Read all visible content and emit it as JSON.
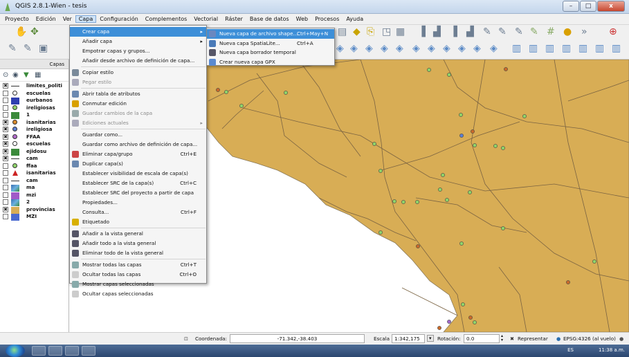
{
  "window": {
    "title": "QGIS 2.8.1-Wien - tesis",
    "min": "–",
    "max": "□",
    "close": "x"
  },
  "menubar": [
    "Proyecto",
    "Edición",
    "Ver",
    "Capa",
    "Configuración",
    "Complementos",
    "Vectorial",
    "Ráster",
    "Base de datos",
    "Web",
    "Procesos",
    "Ayuda"
  ],
  "layers_panel": {
    "title": "Capas",
    "layers": [
      {
        "label": "limites_politi",
        "checked": true,
        "symbol": "line"
      },
      {
        "label": "escuelas",
        "checked": false,
        "symbol": "dot-white"
      },
      {
        "label": "eurbanos",
        "checked": false,
        "symbol": "blue"
      },
      {
        "label": "ireligiosas",
        "checked": false,
        "symbol": "dot-green"
      },
      {
        "label": "1",
        "checked": false,
        "symbol": "green-fill"
      },
      {
        "label": "isanitarias",
        "checked": true,
        "symbol": "dot-orange"
      },
      {
        "label": "ireligiosa",
        "checked": true,
        "symbol": "dot-blue"
      },
      {
        "label": "FFAA",
        "checked": true,
        "symbol": "dot-purple"
      },
      {
        "label": "escuelas",
        "checked": true,
        "symbol": "dot-white"
      },
      {
        "label": "ejidosu",
        "checked": true,
        "symbol": "green-fill"
      },
      {
        "label": "cam",
        "checked": true,
        "symbol": "line"
      },
      {
        "label": "ffaa",
        "checked": false,
        "symbol": "dot-green"
      },
      {
        "label": "isanitarias",
        "checked": false,
        "symbol": "tri-red"
      },
      {
        "label": "cam",
        "checked": false,
        "symbol": "line"
      },
      {
        "label": "ma",
        "checked": false,
        "symbol": "raster"
      },
      {
        "label": "mzi",
        "checked": false,
        "symbol": "purple-fill"
      },
      {
        "label": "2",
        "checked": false,
        "symbol": "raster"
      },
      {
        "label": "provincias",
        "checked": true,
        "symbol": "tan"
      },
      {
        "label": "MZI",
        "checked": false,
        "symbol": "blue-fill"
      }
    ]
  },
  "capa_menu": {
    "items": [
      {
        "label": "Crear capa",
        "shortcut": "",
        "submenu": true,
        "highlighted": true,
        "disabled": false,
        "icon": "none-icon"
      },
      {
        "label": "Añadir capa",
        "shortcut": "",
        "submenu": true,
        "disabled": false,
        "icon": "none-icon"
      },
      {
        "label": "Empotrar capas y grupos...",
        "shortcut": "",
        "disabled": false,
        "icon": "none-icon"
      },
      {
        "label": "Añadir desde archivo de definición de capa...",
        "shortcut": "",
        "disabled": false,
        "icon": "none-icon"
      },
      {
        "sep": true
      },
      {
        "label": "Copiar estilo",
        "shortcut": "",
        "disabled": false,
        "icon": "copy-style-icon"
      },
      {
        "label": "Pegar estilo",
        "shortcut": "",
        "disabled": true,
        "icon": "paste-style-icon"
      },
      {
        "sep": true
      },
      {
        "label": "Abrir tabla de atributos",
        "shortcut": "",
        "disabled": false,
        "icon": "table-icon"
      },
      {
        "label": "Conmutar edición",
        "shortcut": "",
        "disabled": false,
        "icon": "pencil-icon"
      },
      {
        "label": "Guardar cambios de la capa",
        "shortcut": "",
        "disabled": true,
        "icon": "save-icon"
      },
      {
        "label": "Ediciones actuales",
        "shortcut": "",
        "submenu": true,
        "disabled": true,
        "icon": "edit-icon"
      },
      {
        "sep": true
      },
      {
        "label": "Guardar como...",
        "shortcut": "",
        "disabled": false,
        "icon": "none-icon"
      },
      {
        "label": "Guardar como archivo de definición de capa...",
        "shortcut": "",
        "disabled": false,
        "icon": "none-icon"
      },
      {
        "label": "Eliminar capa/grupo",
        "shortcut": "Ctrl+E",
        "disabled": false,
        "icon": "remove-layer-icon"
      },
      {
        "label": "Duplicar capa(s)",
        "shortcut": "",
        "disabled": false,
        "icon": "duplicate-icon"
      },
      {
        "label": "Establecer visibilidad de escala de capa(s)",
        "shortcut": "",
        "disabled": false,
        "icon": "none-icon"
      },
      {
        "label": "Establecer SRC de la capa(s)",
        "shortcut": "Ctrl+C",
        "disabled": false,
        "icon": "none-icon"
      },
      {
        "label": "Establecer SRC del proyecto a partir de capa",
        "shortcut": "",
        "disabled": false,
        "icon": "none-icon"
      },
      {
        "label": "Propiedades...",
        "shortcut": "",
        "disabled": false,
        "icon": "none-icon"
      },
      {
        "label": "Consulta...",
        "shortcut": "Ctrl+F",
        "disabled": false,
        "icon": "none-icon"
      },
      {
        "label": "Etiquetado",
        "shortcut": "",
        "disabled": false,
        "icon": "label-icon"
      },
      {
        "sep": true
      },
      {
        "label": "Añadir a la vista general",
        "shortcut": "",
        "disabled": false,
        "icon": "overview-add-icon"
      },
      {
        "label": "Añadir todo a la vista general",
        "shortcut": "",
        "disabled": false,
        "icon": "overview-addall-icon"
      },
      {
        "label": "Eliminar todo de la vista general",
        "shortcut": "",
        "disabled": false,
        "icon": "overview-remove-icon"
      },
      {
        "sep": true
      },
      {
        "label": "Mostrar todas las capas",
        "shortcut": "Ctrl+T",
        "disabled": false,
        "icon": "eye-icon"
      },
      {
        "label": "Ocultar todas las capas",
        "shortcut": "Ctrl+O",
        "disabled": false,
        "icon": "eye-closed-icon"
      },
      {
        "label": "Mostrar capas seleccionadas",
        "shortcut": "",
        "disabled": false,
        "icon": "eye-icon"
      },
      {
        "label": "Ocultar capas seleccionadas",
        "shortcut": "",
        "disabled": false,
        "icon": "eye-closed-icon"
      }
    ]
  },
  "crear_submenu": {
    "items": [
      {
        "label": "Nueva capa de archivo shape...",
        "shortcut": "Ctrl+May+N",
        "highlighted": true,
        "icon": "new-shapefile-icon"
      },
      {
        "label": "Nueva capa SpatiaLite...",
        "shortcut": "Ctrl+A",
        "icon": "new-spatialite-icon"
      },
      {
        "label": "Nueva capa borrador temporal",
        "shortcut": "",
        "icon": "new-temp-layer-icon"
      },
      {
        "label": "Crear nueva capa GPX",
        "shortcut": "",
        "icon": "new-gpx-icon"
      }
    ]
  },
  "statusbar": {
    "coord_label": "Coordenada:",
    "coord_value": "-71.342,-38.403",
    "scale_label": "Escala",
    "scale_value": "1:342,175",
    "rotation_label": "Rotación:",
    "rotation_value": "0.0",
    "render_label": "Representar",
    "crs_label": "EPSG:4326 (al vuelo)"
  },
  "taskbar": {
    "lang": "ES",
    "clock": "11:38 a.m."
  },
  "colors": {
    "land": "#d8ad55",
    "highlight": "#3d8fd8",
    "roads": "#7a6342"
  }
}
